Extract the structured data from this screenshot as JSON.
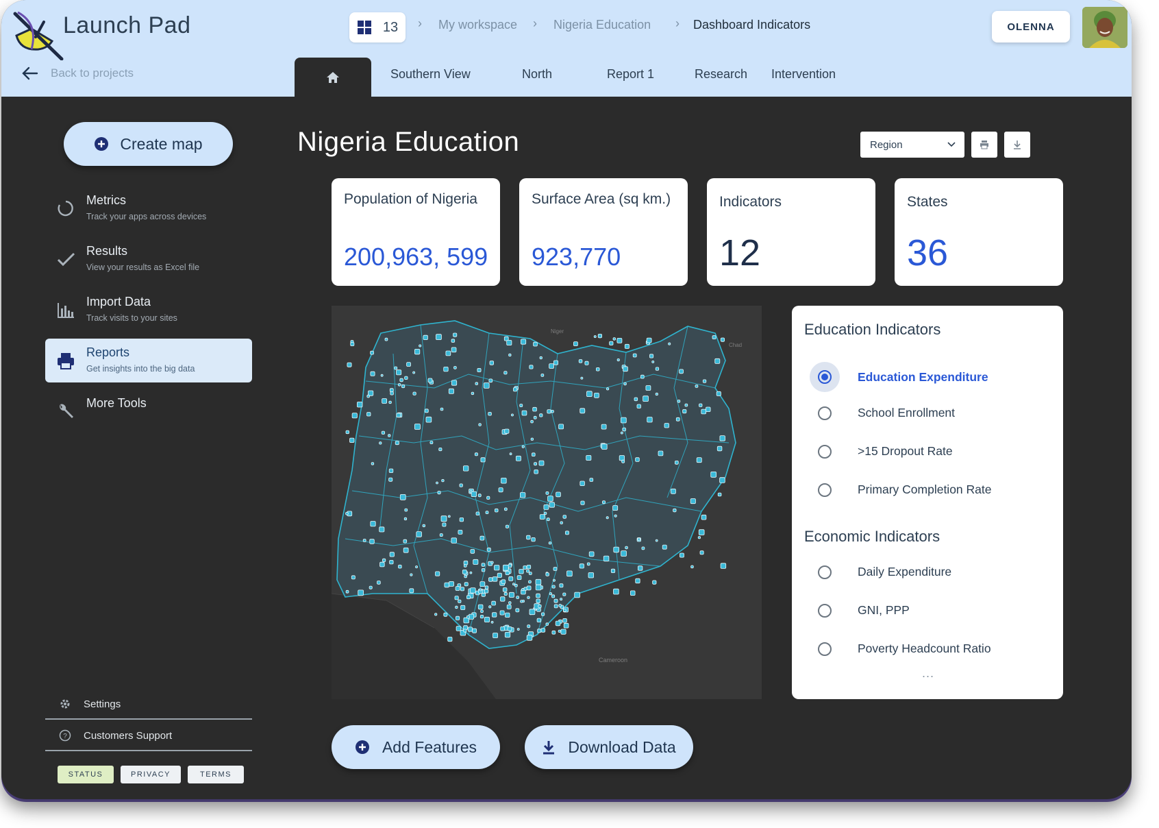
{
  "header": {
    "app_title": "Launch Pad",
    "back_label": "Back to projects",
    "grid_count": "13",
    "breadcrumbs": [
      "My workspace",
      "Nigeria Education",
      "Dashboard Indicators"
    ],
    "user_label": "OLENNA"
  },
  "tabs": [
    {
      "icon": "home-icon"
    },
    {
      "label": "Southern View"
    },
    {
      "label": "North"
    },
    {
      "label": "Report 1"
    },
    {
      "label": "Research"
    },
    {
      "label": "Intervention"
    }
  ],
  "sidebar": {
    "create_label": "Create map",
    "items": [
      {
        "title": "Metrics",
        "subtitle": "Track your apps across devices",
        "icon": "circle-progress-icon"
      },
      {
        "title": "Results",
        "subtitle": "View your results as Excel file",
        "icon": "check-icon"
      },
      {
        "title": "Import Data",
        "subtitle": "Track visits to your sites",
        "icon": "bar-chart-icon"
      },
      {
        "title": "Reports",
        "subtitle": "Get insights into the big data",
        "icon": "printer-icon",
        "active": true
      },
      {
        "title": "More Tools",
        "subtitle": "",
        "icon": "wrench-icon"
      }
    ],
    "footer_links": [
      {
        "label": "Settings",
        "icon": "gear-icon"
      },
      {
        "label": "Customers Support",
        "icon": "help-icon"
      }
    ],
    "pills": [
      "STATUS",
      "PRIVACY",
      "TERMS"
    ]
  },
  "main": {
    "title": "Nigeria Education",
    "region_select": "Region",
    "stats": [
      {
        "label": "Population of Nigeria",
        "value": "200,963, 599"
      },
      {
        "label": "Surface Area (sq km.)",
        "value": "923,770"
      },
      {
        "label": "Indicators",
        "value": "12"
      },
      {
        "label": "States",
        "value": "36"
      }
    ],
    "panel": {
      "education_heading": "Education Indicators",
      "education": [
        "Education Expenditure",
        "School Enrollment",
        ">15 Dropout Rate",
        "Primary Completion Rate"
      ],
      "selected": "Education Expenditure",
      "economic_heading": "Economic Indicators",
      "economic": [
        "Daily Expenditure",
        "GNI, PPP",
        "Poverty Headcount Ratio"
      ],
      "more": "..."
    },
    "map_labels": [
      "Niger",
      "Chad",
      "Cameroon"
    ],
    "actions": {
      "add_label": "Add Features",
      "download_label": "Download Data"
    }
  },
  "colors": {
    "header_bg": "#cfe4fb",
    "body_bg": "#2b2b2b",
    "accent_blue": "#2a58d6",
    "map_marker": "#3ab9d8"
  }
}
